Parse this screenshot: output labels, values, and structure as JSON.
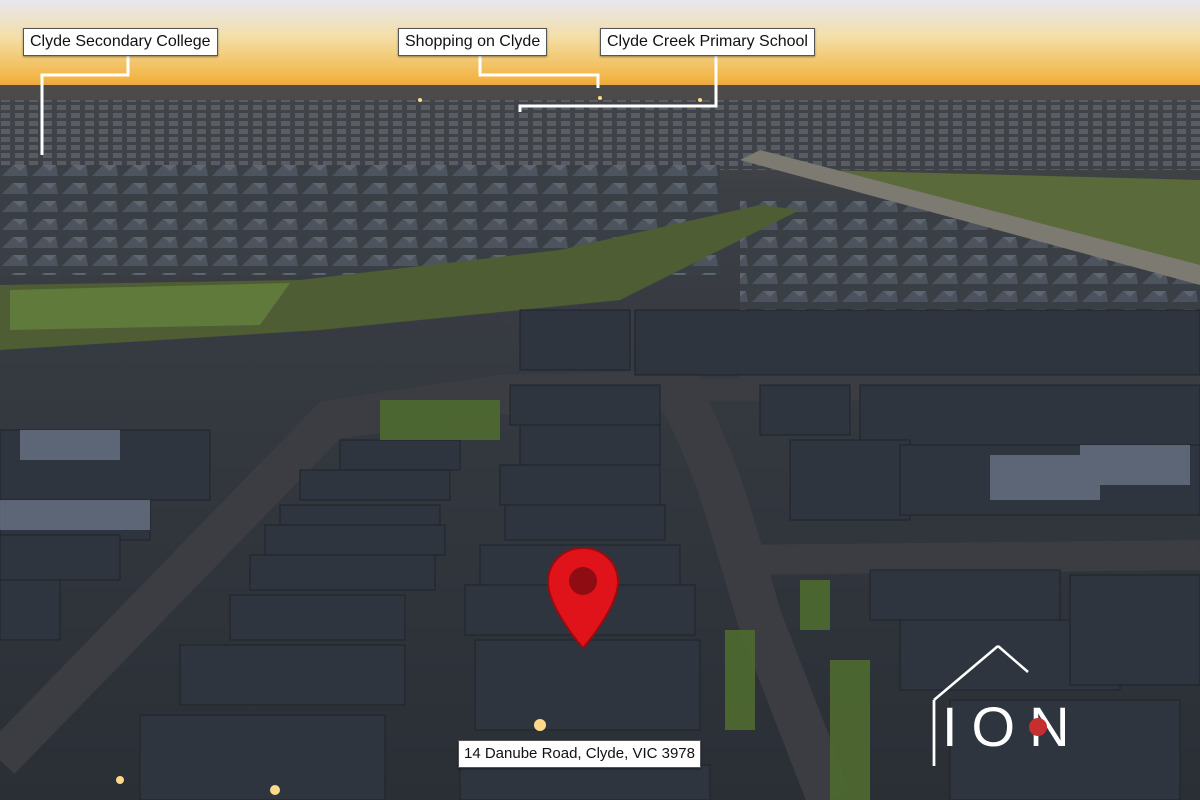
{
  "labels": {
    "college": "Clyde Secondary College",
    "shopping": "Shopping on Clyde",
    "school": "Clyde Creek Primary School",
    "address": "14 Danube Road, Clyde, VIC 3978"
  },
  "logo": {
    "text": "ION"
  },
  "icons": [
    "location-pin-icon",
    "ion-house-logo"
  ],
  "colors": {
    "pin": "#e0131a",
    "sky_glow": "#f3b23d",
    "label_bg": "#ffffff"
  }
}
